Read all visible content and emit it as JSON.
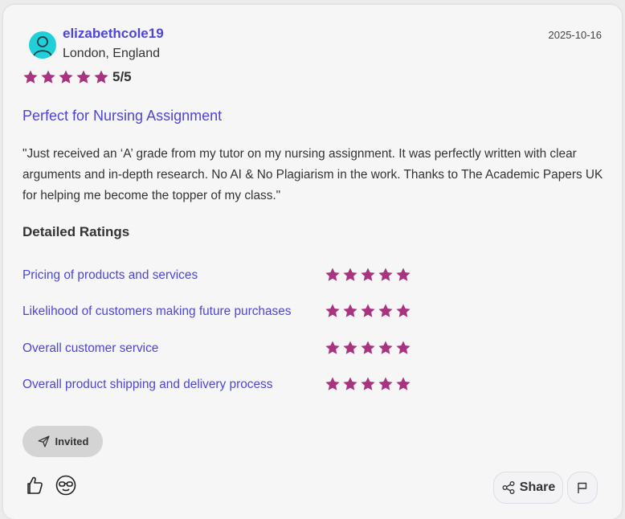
{
  "review": {
    "username": "elizabethcole19",
    "location": "London, England",
    "date": "2025-10-16",
    "overall_rating": 5,
    "overall_score_text": "5/5",
    "title": "Perfect for Nursing Assignment",
    "body": "\"Just received an ‘A’ grade from my tutor on my nursing assignment. It was perfectly written with clear arguments and in-depth research. No AI & No Plagiarism in the work. Thanks to The Academic Papers UK for helping me become the topper of my class.\""
  },
  "detailed": {
    "heading": "Detailed Ratings",
    "items": [
      {
        "label": "Pricing of products and services",
        "rating": 5
      },
      {
        "label": "Likelihood of customers making future purchases",
        "rating": 5
      },
      {
        "label": "Overall customer service",
        "rating": 5
      },
      {
        "label": "Overall product shipping and delivery process",
        "rating": 5
      }
    ]
  },
  "badge": {
    "label": "Invited",
    "icon": "paper-plane-icon"
  },
  "actions": {
    "share_label": "Share",
    "share_icon": "share-icon",
    "flag_icon": "flag-icon",
    "helpful_icon": "thumbs-up-icon",
    "funny_icon": "glasses-face-icon"
  },
  "colors": {
    "accent": "#4d45d8",
    "star": "#a8337f",
    "avatar": "#20d0d8",
    "card": "#f6f6f7",
    "badge_bg": "#d4d4d4"
  }
}
